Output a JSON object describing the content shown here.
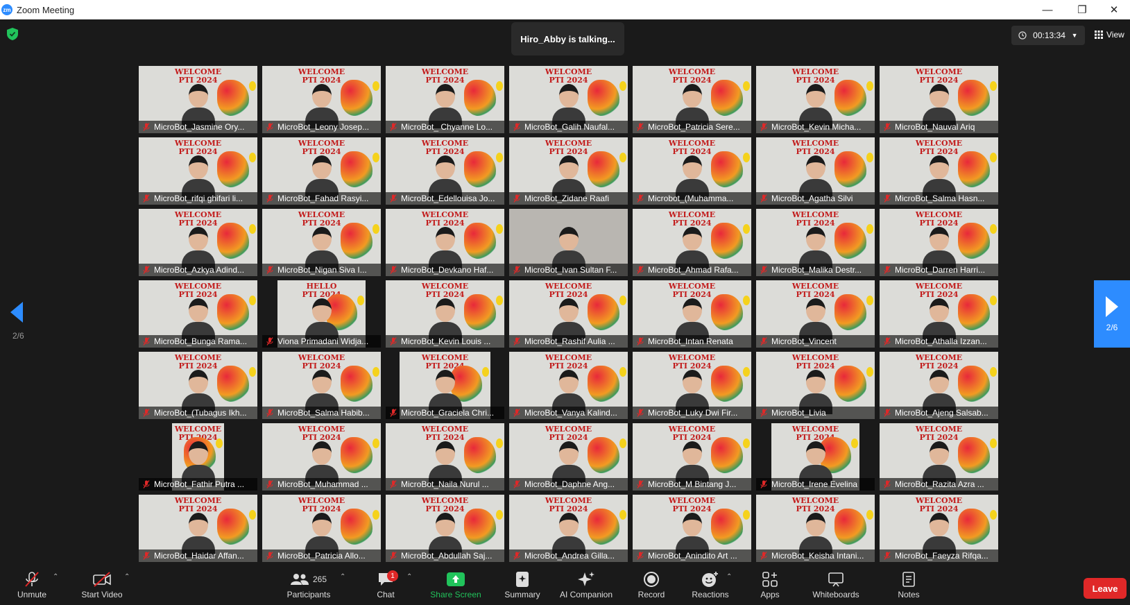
{
  "window": {
    "title": "Zoom Meeting",
    "app_icon": "zm"
  },
  "header": {
    "talking": "Hiro_Abby is talking...",
    "timer": "00:13:34",
    "view_label": "View"
  },
  "pager": {
    "left": "2/6",
    "right": "2/6"
  },
  "tiles": [
    {
      "name": "MicroBot_Jasmine Ory...",
      "banner1": "WELCOME",
      "banner2": "PTI 2024"
    },
    {
      "name": "MicroBot_Leony Josep...",
      "banner1": "WELCOME",
      "banner2": "PTI 2024"
    },
    {
      "name": "MicroBot_ Chyanne Lo...",
      "banner1": "WELCOME",
      "banner2": "PTI 2024"
    },
    {
      "name": "MicroBot_Galih Naufal...",
      "banner1": "WELCOME",
      "banner2": "PTI 2024"
    },
    {
      "name": "MicroBot_Patricia Sere...",
      "banner1": "WELCOME",
      "banner2": "PTI 2024"
    },
    {
      "name": "MicroBot_Kevin Micha...",
      "banner1": "WELCOME",
      "banner2": "PTI 2024"
    },
    {
      "name": "MicroBot_Nauval Ariq",
      "banner1": "WELCOME",
      "banner2": "PTI 2024"
    },
    {
      "name": "MicroBot_rifqi ghifari li...",
      "banner1": "WELCOME",
      "banner2": "PTI 2024"
    },
    {
      "name": "MicroBot_Fahad Rasyi...",
      "banner1": "WELCOME",
      "banner2": "PTI 2024"
    },
    {
      "name": "MicroBot_Edellouisa Jo...",
      "banner1": "WELCOME",
      "banner2": "PTI 2024"
    },
    {
      "name": "MicroBot_Zidane Raafi",
      "banner1": "WELCOME",
      "banner2": "PTI 2024"
    },
    {
      "name": "Microbot_(Muhamma...",
      "banner1": "WELCOME",
      "banner2": "PTI 2024"
    },
    {
      "name": "MicroBot_Agatha Silvi",
      "banner1": "WELCOME",
      "banner2": "PTI 2024"
    },
    {
      "name": "MicroBot_Salma Hasn...",
      "banner1": "WELCOME",
      "banner2": "PTI 2024"
    },
    {
      "name": "MicroBot_Azkya Adind...",
      "banner1": "WELCOME",
      "banner2": "PTI 2024"
    },
    {
      "name": "MicroBot_Nigan Siva I...",
      "banner1": "WELCOME",
      "banner2": "PTI 2024"
    },
    {
      "name": "MicroBot_Devkano Haf...",
      "banner1": "WELCOME",
      "banner2": "PTI 2024"
    },
    {
      "name": "MicroBot_Ivan Sultan F...",
      "banner1": "",
      "banner2": ""
    },
    {
      "name": "MicroBot_Ahmad Rafa...",
      "banner1": "WELCOME",
      "banner2": "PTI 2024"
    },
    {
      "name": "MicroBot_Malika Destr...",
      "banner1": "WELCOME",
      "banner2": "PTI 2024"
    },
    {
      "name": "MicroBot_Darren Harri...",
      "banner1": "WELCOME",
      "banner2": "PTI 2024"
    },
    {
      "name": "MicroBot_Bunga Rama...",
      "banner1": "WELCOME",
      "banner2": "PTI 2024"
    },
    {
      "name": "Viona Primadani Widja...",
      "banner1": "HELLO",
      "banner2": "PTI 2024"
    },
    {
      "name": "MicroBot_Kevin Louis ...",
      "banner1": "WELCOME",
      "banner2": "PTI 2024"
    },
    {
      "name": "MicroBot_Rashif Aulia ...",
      "banner1": "WELCOME",
      "banner2": "PTI 2024"
    },
    {
      "name": "MicroBot_Intan Renata",
      "banner1": "WELCOME",
      "banner2": "PTI 2024"
    },
    {
      "name": "MicroBot_Vincent",
      "banner1": "WELCOME",
      "banner2": "PTI 2024"
    },
    {
      "name": "MicroBot_Athalla Izzan...",
      "banner1": "WELCOME",
      "banner2": "PTI 2024"
    },
    {
      "name": "MicroBot_(Tubagus Ikh...",
      "banner1": "WELCOME",
      "banner2": "PTI 2024"
    },
    {
      "name": "MicroBot_Salma Habib...",
      "banner1": "WELCOME",
      "banner2": "PTI 2024"
    },
    {
      "name": "MicroBot_Graciela Chri...",
      "banner1": "WELCOME",
      "banner2": "PTI 2024"
    },
    {
      "name": "MicroBot_Vanya Kalind...",
      "banner1": "WELCOME",
      "banner2": "PTI 2024"
    },
    {
      "name": "MicroBot_Luky Dwi Fir...",
      "banner1": "WELCOME",
      "banner2": "PTI 2024"
    },
    {
      "name": "MicroBot_Livia",
      "banner1": "WELCOME",
      "banner2": "PTI 2024"
    },
    {
      "name": "MicroBot_Ajeng Salsab...",
      "banner1": "WELCOME",
      "banner2": "PTI 2024"
    },
    {
      "name": "MicroBot_Fathir Putra ...",
      "banner1": "WELCOME",
      "banner2": "PTI 2024"
    },
    {
      "name": "MicroBot_Muhammad ...",
      "banner1": "WELCOME",
      "banner2": "PTI 2024"
    },
    {
      "name": "MicroBot_Naila Nurul ...",
      "banner1": "WELCOME",
      "banner2": "PTI 2024"
    },
    {
      "name": "MicroBot_Daphne Ang...",
      "banner1": "WELCOME",
      "banner2": "PTI 2024"
    },
    {
      "name": "MicroBot_M Bintang J...",
      "banner1": "WELCOME",
      "banner2": "PTI 2024"
    },
    {
      "name": "MicroBot_Irene Evelina",
      "banner1": "WELCOME",
      "banner2": "PTI 2024"
    },
    {
      "name": "MicroBot_Razita Azra ...",
      "banner1": "WELCOME",
      "banner2": "PTI 2024"
    },
    {
      "name": "MicroBot_Haidar Affan...",
      "banner1": "WELCOME",
      "banner2": "PTI 2024"
    },
    {
      "name": "MicroBot_Patricia Allo...",
      "banner1": "WELCOME",
      "banner2": "PTI 2024"
    },
    {
      "name": "MicroBot_Abdullah Saj...",
      "banner1": "WELCOME",
      "banner2": "PTI 2024"
    },
    {
      "name": "MicroBot_Andrea Gilla...",
      "banner1": "WELCOME",
      "banner2": "PTI 2024"
    },
    {
      "name": "MicroBot_Anindito Art ...",
      "banner1": "WELCOME",
      "banner2": "PTI 2024"
    },
    {
      "name": "MicroBot_Keisha Intani...",
      "banner1": "WELCOME",
      "banner2": "PTI 2024"
    },
    {
      "name": "MicroBot_Faeyza Rifqa...",
      "banner1": "WELCOME",
      "banner2": "PTI 2024"
    }
  ],
  "toolbar": {
    "unmute": "Unmute",
    "start_video": "Start Video",
    "participants": "Participants",
    "participants_count": "265",
    "chat": "Chat",
    "chat_badge": "1",
    "share_screen": "Share Screen",
    "summary": "Summary",
    "ai_companion": "AI Companion",
    "record": "Record",
    "reactions": "Reactions",
    "apps": "Apps",
    "whiteboards": "Whiteboards",
    "notes": "Notes",
    "leave": "Leave"
  },
  "colors": {
    "accent": "#2d8cff",
    "share_green": "#21c35b",
    "leave_red": "#e02828",
    "banner_red": "#c21b1b"
  }
}
